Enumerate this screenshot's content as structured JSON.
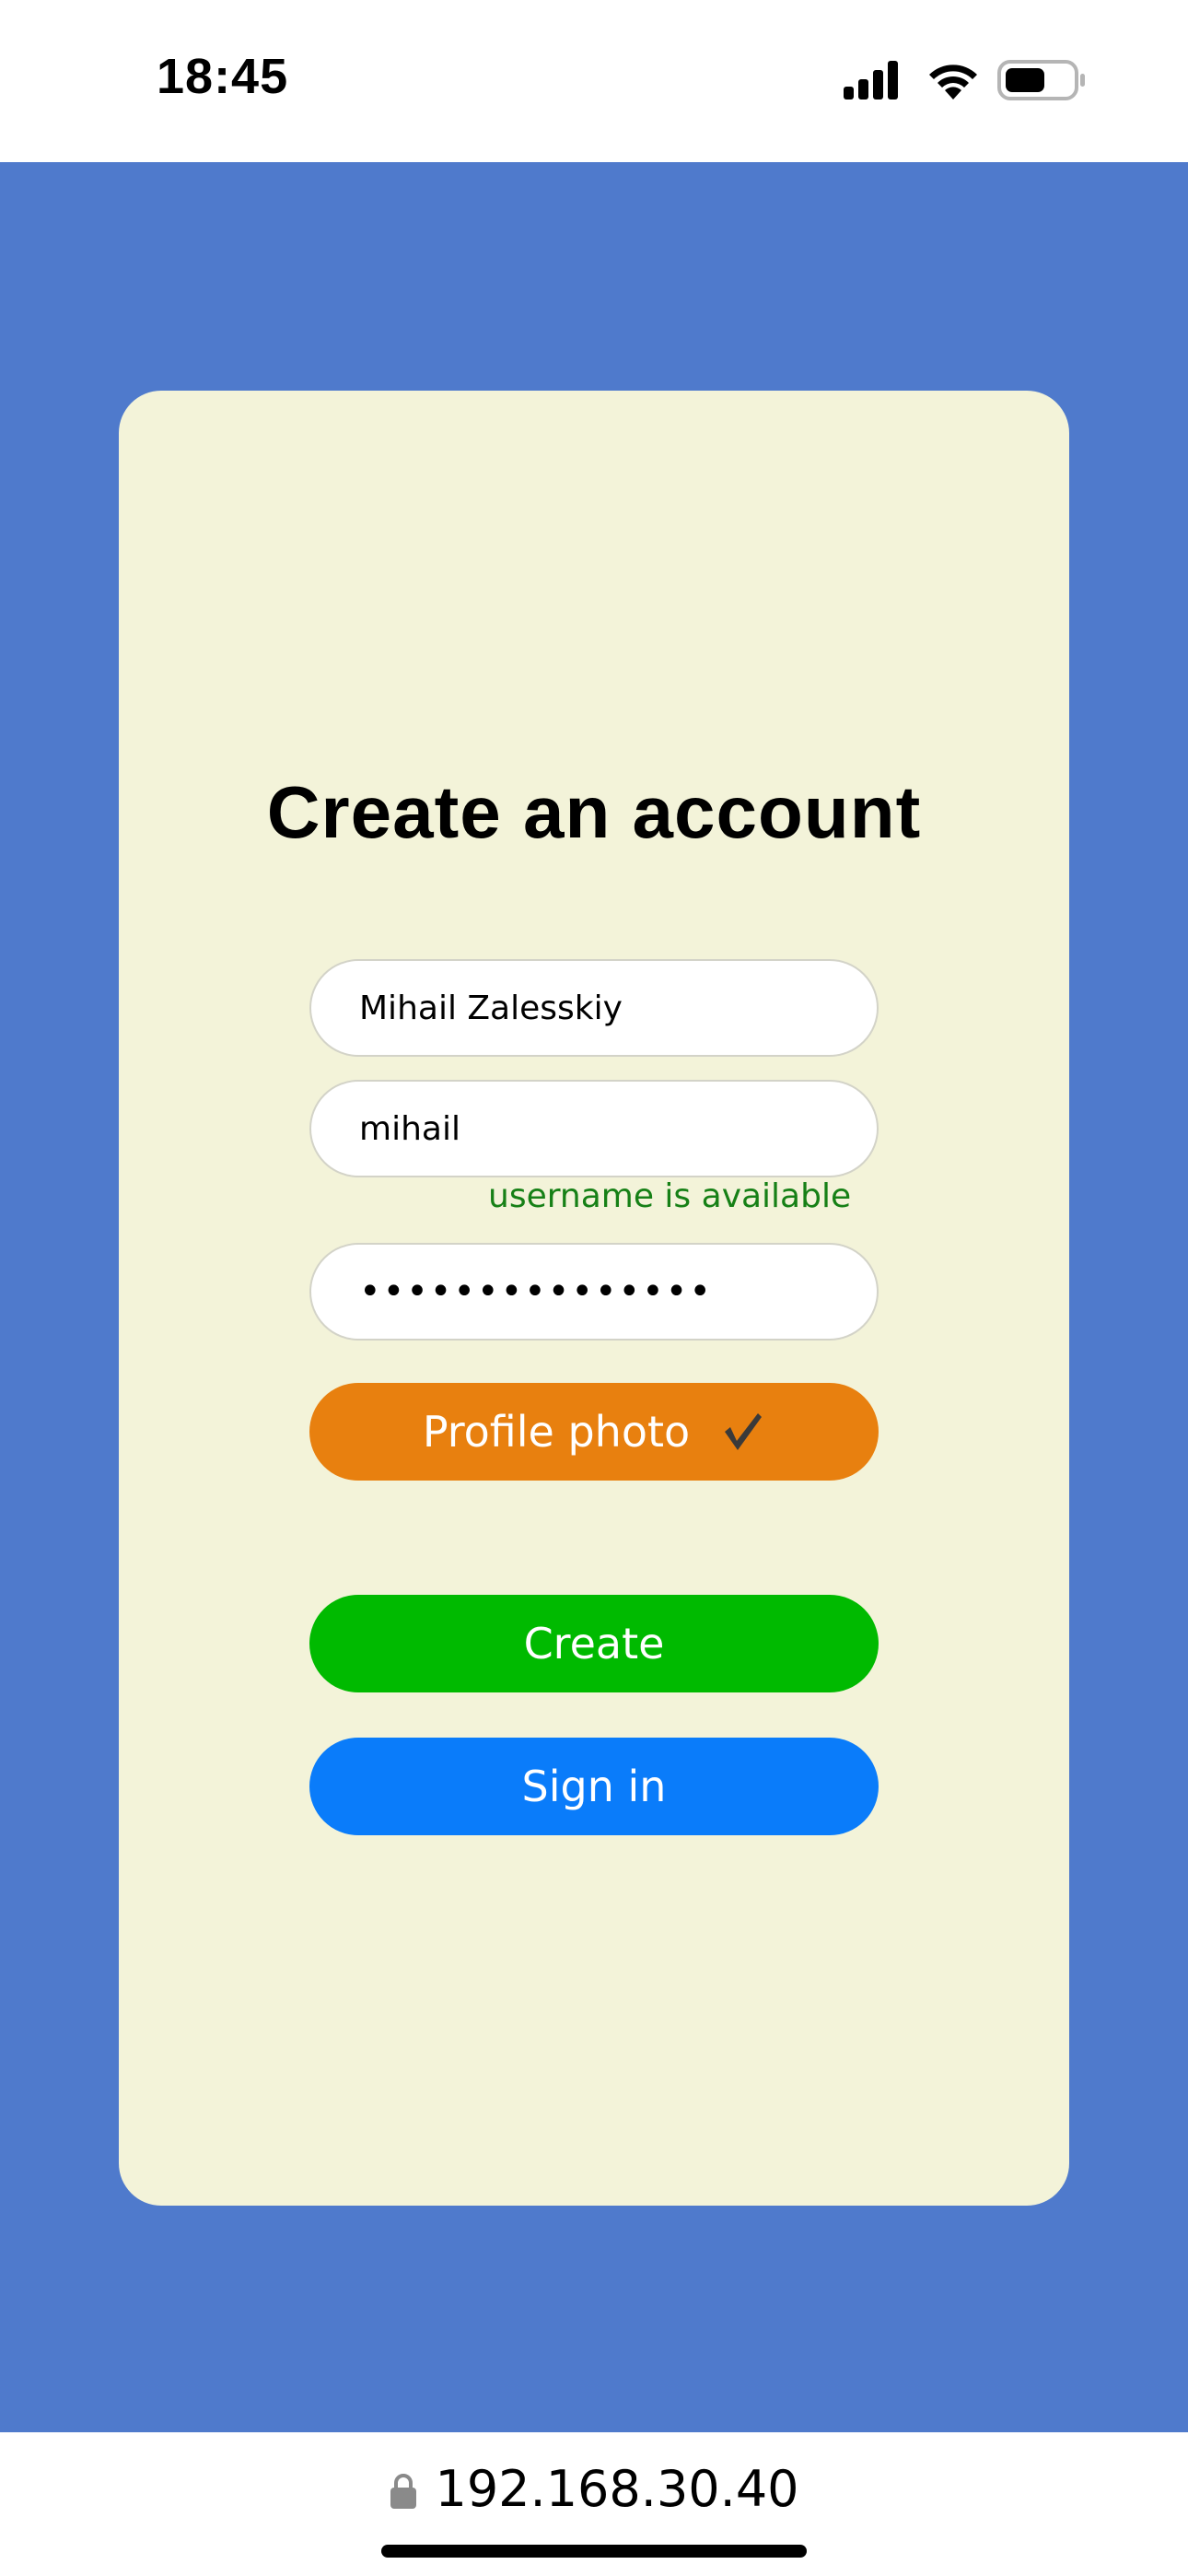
{
  "status_bar": {
    "time": "18:45"
  },
  "colors": {
    "page_background": "#4f7acc",
    "card_background": "#f3f3d9",
    "photo_button": "#e8800f",
    "create_button": "#00ba00",
    "signin_button": "#0a7cfa",
    "availability_text": "#168016"
  },
  "form": {
    "title": "Create an account",
    "full_name_value": "Mihail Zalesskiy",
    "username_value": "mihail",
    "username_status": "username is available",
    "password_value": "•••••••••••••••",
    "profile_photo_label": "Profile photo",
    "profile_photo_icon": "checkmark-icon",
    "create_label": "Create",
    "signin_label": "Sign in"
  },
  "browser": {
    "url": "192.168.30.40",
    "secure_icon": "lock-icon"
  }
}
